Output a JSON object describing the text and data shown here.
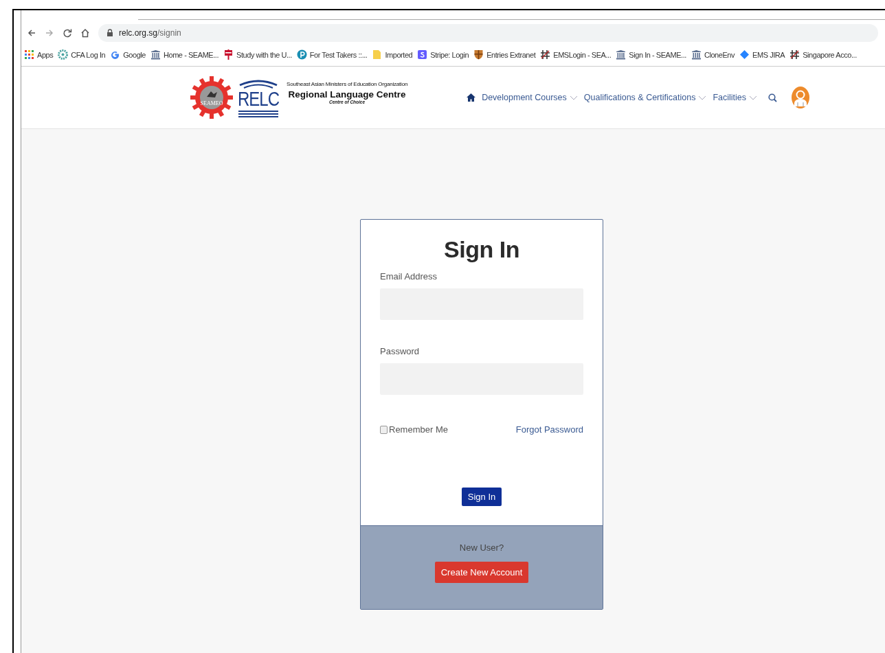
{
  "browser": {
    "url_host": "relc.org.sg",
    "url_path": "/signin",
    "bookmarks": [
      {
        "label": "Apps"
      },
      {
        "label": "CFA Log In"
      },
      {
        "label": "Google"
      },
      {
        "label": "Home - SEAME..."
      },
      {
        "label": "Study with the U..."
      },
      {
        "label": "For Test Takers ::..."
      },
      {
        "label": "Imported"
      },
      {
        "label": "Stripe: Login"
      },
      {
        "label": "Entries Extranet"
      },
      {
        "label": "EMSLogin - SEA..."
      },
      {
        "label": "Sign In - SEAME..."
      },
      {
        "label": "CloneEnv"
      },
      {
        "label": "EMS JIRA"
      },
      {
        "label": "Singapore Acco..."
      }
    ]
  },
  "header": {
    "logo": {
      "badge": "SEAMEO",
      "acronym": "RELC",
      "org": "Southeast Asian Ministers of Education Organization",
      "name": "Regional Language Centre",
      "tagline": "Centre of Choice"
    },
    "nav": [
      {
        "label": "Development Courses",
        "has_menu": true
      },
      {
        "label": "Qualifications & Certifications",
        "has_menu": true
      },
      {
        "label": "Facilities",
        "has_menu": true
      }
    ]
  },
  "signin": {
    "title": "Sign In",
    "fields": [
      {
        "label": "Email Address"
      },
      {
        "label": "Password"
      }
    ],
    "remember": {
      "label": "Remember Me",
      "checked": false
    },
    "forgot_link": "Forgot Password",
    "submit": "Sign In",
    "footer": {
      "prompt": "New User?",
      "button": "Create New Account"
    }
  }
}
